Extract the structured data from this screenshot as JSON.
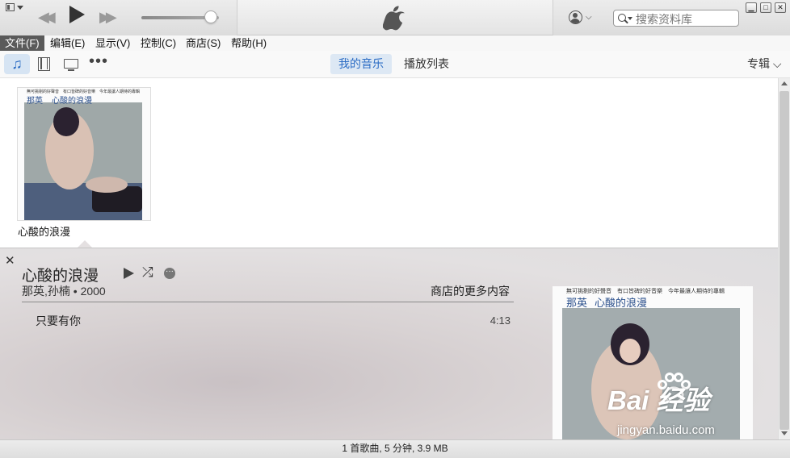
{
  "menu": [
    {
      "label": "文件(F)",
      "active": true
    },
    {
      "label": "编辑(E)"
    },
    {
      "label": "显示(V)"
    },
    {
      "label": "控制(C)"
    },
    {
      "label": "商店(S)"
    },
    {
      "label": "帮助(H)"
    }
  ],
  "search": {
    "placeholder": "搜索资料库"
  },
  "volume": {
    "level": 0.9
  },
  "toolbar": {
    "tabs": [
      "我的音乐",
      "播放列表"
    ],
    "active_tab": "我的音乐",
    "view_label": "专辑 ⌵",
    "media_icons": [
      "music-note-icon",
      "film-icon",
      "tv-icon",
      "more-icon"
    ]
  },
  "albums": [
    {
      "title": "心酸的浪漫",
      "cover_text": {
        "top_line": "無可挑剔的好聲音　有口皆碑的好音樂　今年最讓人期待的專輯",
        "artist": "那英",
        "album": "心酸的浪漫"
      }
    }
  ],
  "detail": {
    "title": "心酸的浪漫",
    "artist_line": "那英,孙楠 • 2000",
    "store_link": "商店的更多内容",
    "tracks": [
      {
        "name": "只要有你",
        "time": "4:13"
      }
    ]
  },
  "status": "1 首歌曲, 5 分钟, 3.9 MB",
  "watermark": {
    "brand": "Bai 经验",
    "url": "jingyan.baidu.com"
  },
  "colors": {
    "accent": "#2b6cc4",
    "tab_active_bg": "#dde8f4"
  }
}
